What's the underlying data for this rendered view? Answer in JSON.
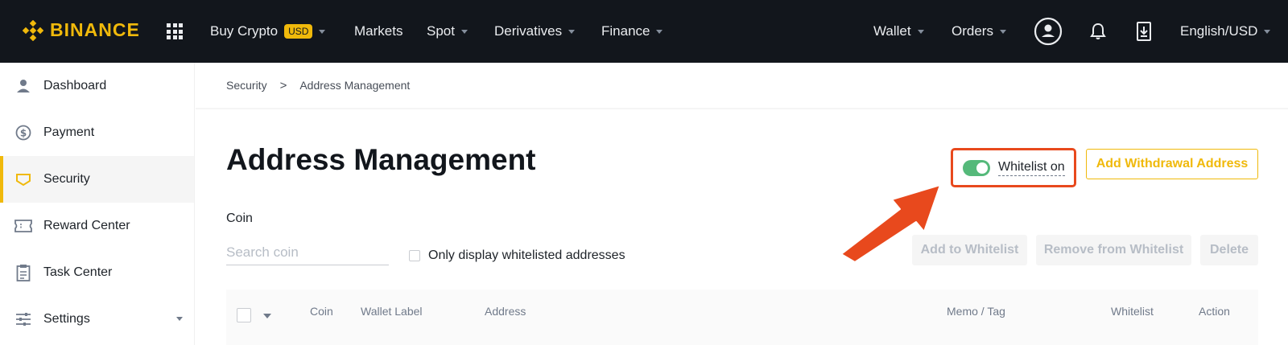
{
  "brand": {
    "name": "BINANCE",
    "accent": "#f0b90b",
    "annotation_color": "#e8491d"
  },
  "topnav": {
    "buy_crypto": "Buy Crypto",
    "buy_crypto_badge": "USD",
    "markets": "Markets",
    "spot": "Spot",
    "derivatives": "Derivatives",
    "finance": "Finance",
    "wallet": "Wallet",
    "orders": "Orders",
    "language": "English/USD",
    "icons": [
      "apps-grid-icon",
      "user-icon",
      "bell-icon",
      "download-icon"
    ]
  },
  "sidebar": {
    "items": [
      {
        "label": "Dashboard",
        "icon": "user-icon"
      },
      {
        "label": "Payment",
        "icon": "dollar-icon"
      },
      {
        "label": "Security",
        "icon": "shield-icon",
        "active": true
      },
      {
        "label": "Reward Center",
        "icon": "ticket-icon"
      },
      {
        "label": "Task Center",
        "icon": "clipboard-icon"
      },
      {
        "label": "Settings",
        "icon": "sliders-icon"
      }
    ]
  },
  "breadcrumb": {
    "parent": "Security",
    "separator": ">",
    "current": "Address Management"
  },
  "page": {
    "title": "Address Management",
    "whitelist_label": "Whitelist on",
    "whitelist_enabled": true,
    "add_button": "Add Withdrawal Address"
  },
  "filters": {
    "coin_label": "Coin",
    "search_placeholder": "Search coin",
    "only_whitelisted_label": "Only display whitelisted addresses",
    "add_to_whitelist": "Add to Whitelist",
    "remove_from_whitelist": "Remove from Whitelist",
    "delete": "Delete"
  },
  "table": {
    "columns": [
      "Coin",
      "Wallet Label",
      "Address",
      "Memo / Tag",
      "Whitelist",
      "Action"
    ]
  }
}
